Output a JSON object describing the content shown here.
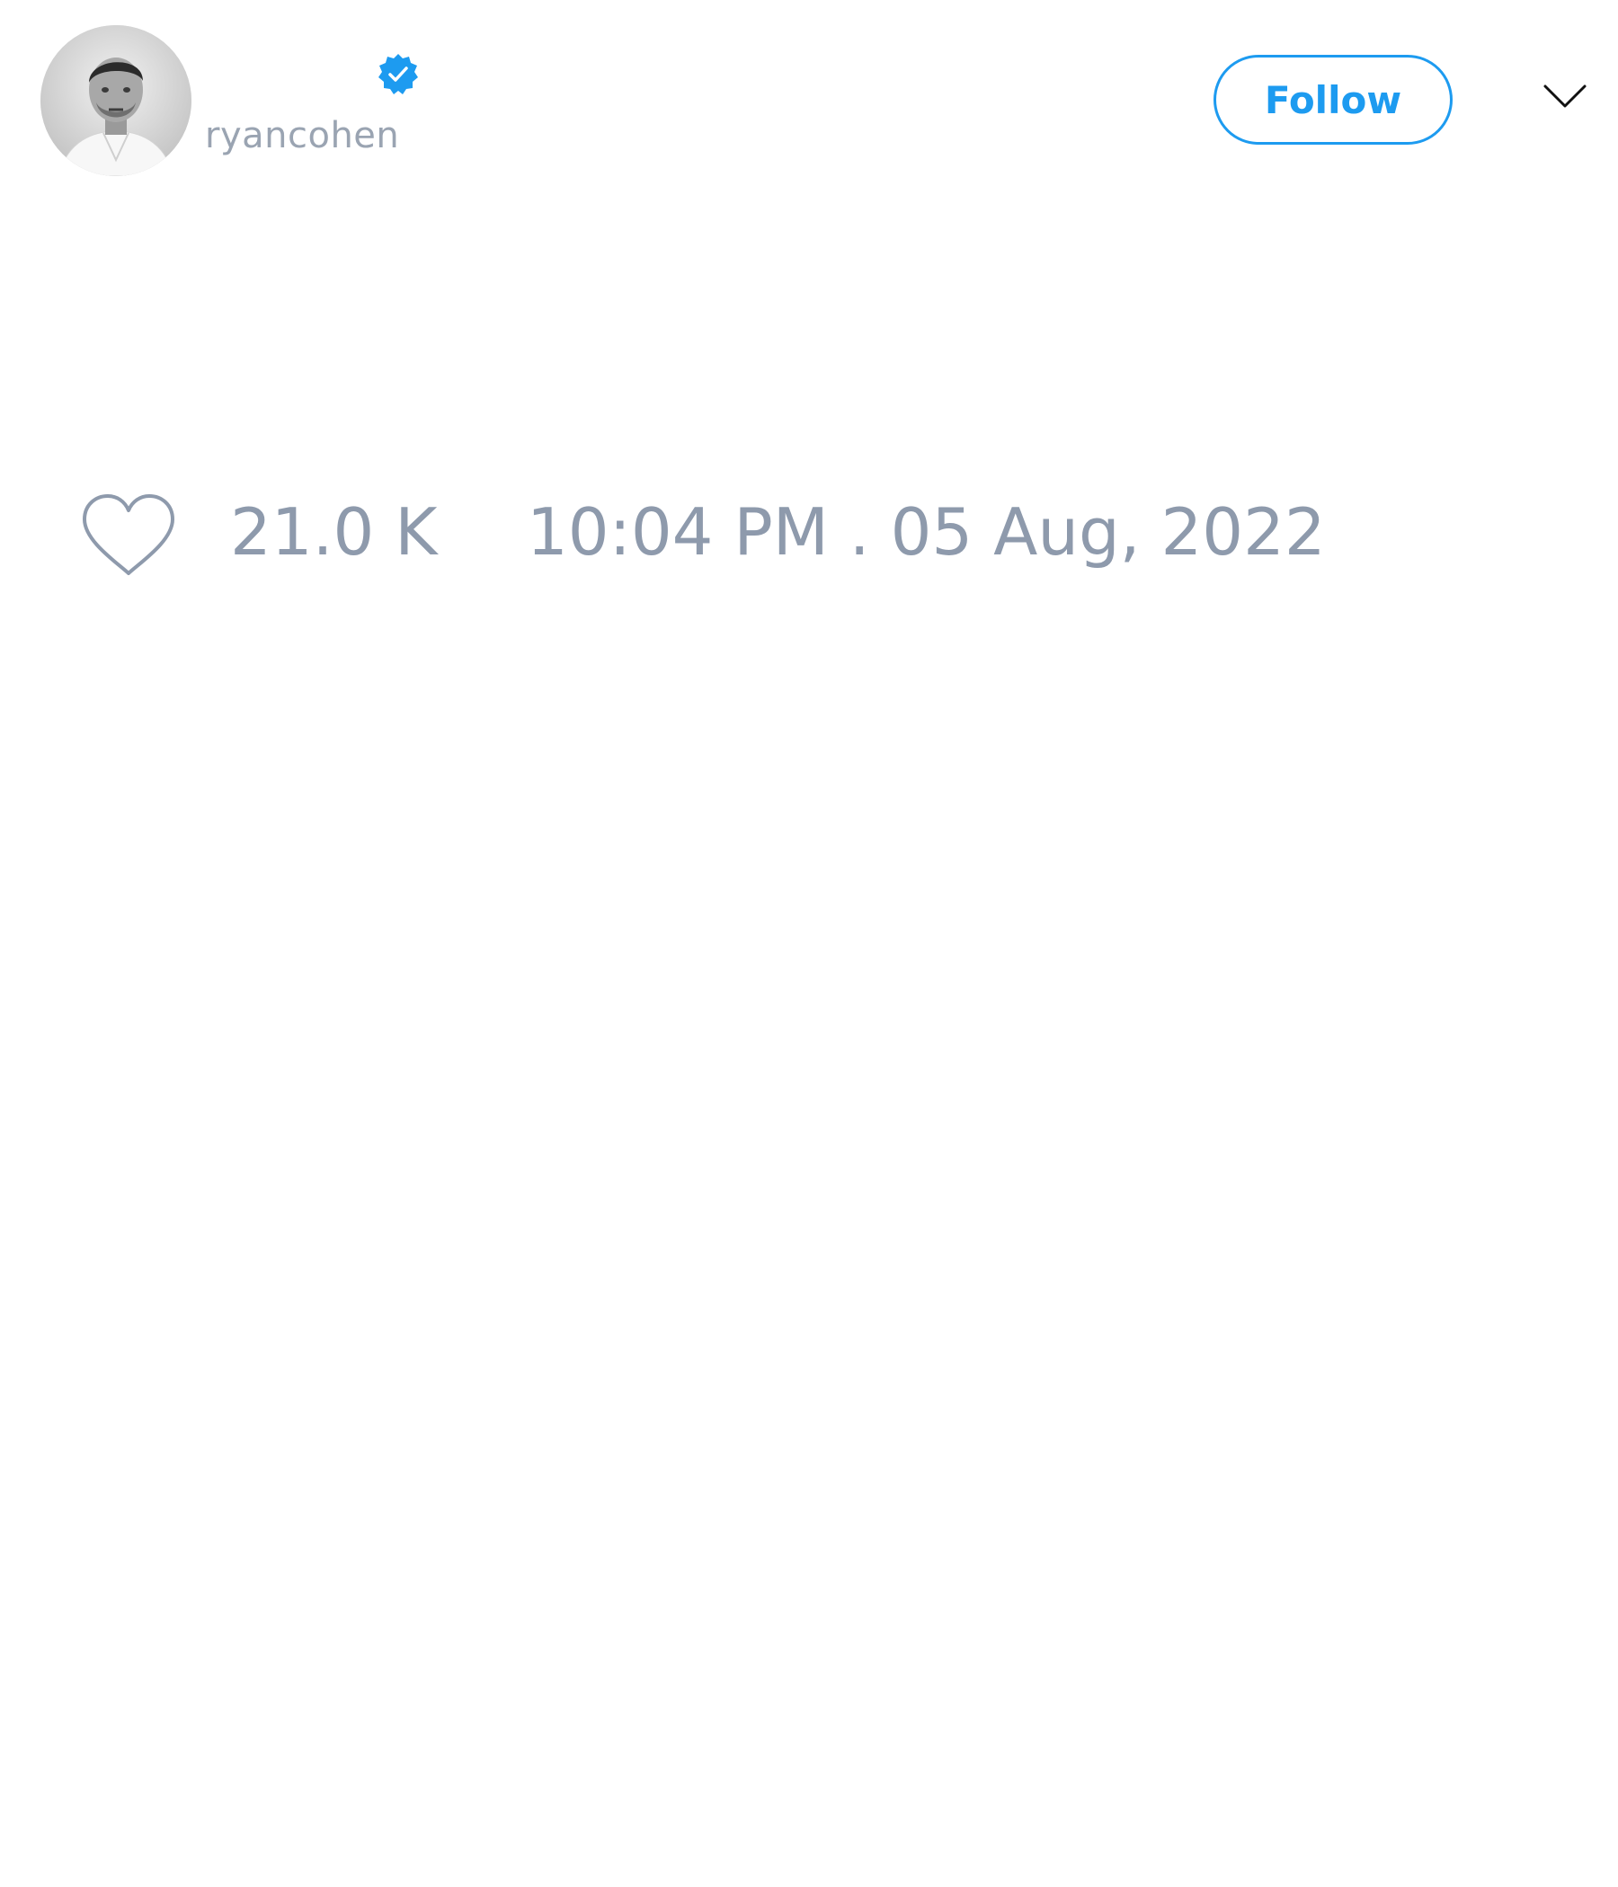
{
  "tweet": {
    "author": {
      "display_name": "",
      "handle": "ryancohen",
      "verified": true,
      "avatar_icon": "profile-photo"
    },
    "follow_button_label": "Follow",
    "menu_icon": "chevron-down-icon",
    "like_icon": "heart-outline-icon",
    "like_count": "21.0 K",
    "timestamp": "10:04 PM . 05 Aug, 2022"
  },
  "colors": {
    "accent": "#1d9bf0",
    "muted_text": "#8e9aac",
    "handle_text": "#9aa4b2",
    "background": "#ffffff"
  }
}
